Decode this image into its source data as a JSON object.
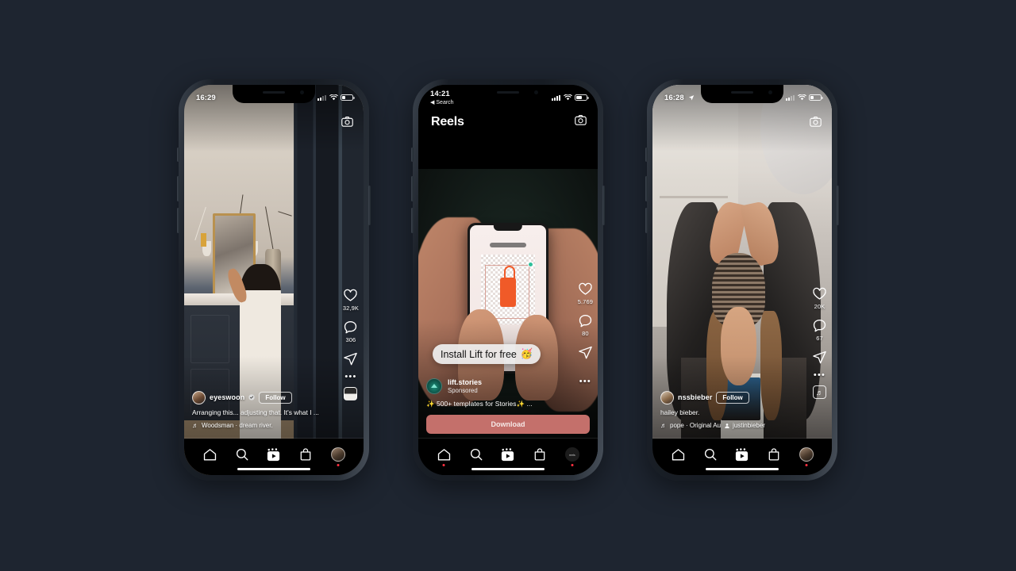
{
  "background_color": "#1e2530",
  "phones": [
    {
      "id": "phone-left",
      "app": "Instagram",
      "screen": "reels-feed",
      "status_bar": {
        "time": "16:29",
        "signal": "2 of 4 bars",
        "wifi": "wifi-icon",
        "battery": "battery-low-icon"
      },
      "camera_button": "camera-icon",
      "post": {
        "username": "eyeswoon",
        "verified": true,
        "follow_label": "Follow",
        "caption": "Arranging this... adjusting that. It's what I ...",
        "audio": "Woodsman · dream river.",
        "audio_icon": "music-note-icon"
      },
      "actions": {
        "like_count": "32,9K",
        "comment_count": "306",
        "share": "share-icon",
        "more": "more-options-icon",
        "audio_thumb": "audio-cover-thumbnail"
      },
      "tabbar": [
        "home-icon",
        "search-icon",
        "reels-icon",
        "shop-icon",
        "profile-avatar"
      ]
    },
    {
      "id": "phone-middle",
      "app": "Instagram",
      "screen": "reels-sponsored",
      "status_bar": {
        "time": "14:21",
        "back_label": "Search",
        "signal": "4 of 4 bars",
        "wifi": "wifi-icon",
        "battery": "battery-half-icon"
      },
      "header": {
        "title": "Reels",
        "camera_button": "camera-icon"
      },
      "overlay_bubble": {
        "text": "Install Lift for free",
        "emoji": "🥳"
      },
      "ad": {
        "account": "lift.stories",
        "label": "Sponsored",
        "caption": "✨ 500+ templates for Stories✨ ...",
        "cta_label": "Download",
        "cta_color": "#c4706b"
      },
      "actions": {
        "like_count": "5.769",
        "comment_count": "80",
        "share": "share-icon",
        "more": "more-options-icon"
      },
      "tabbar": [
        "home-icon",
        "search-icon",
        "reels-icon",
        "shop-icon",
        "reels-avatar"
      ]
    },
    {
      "id": "phone-right",
      "app": "Instagram",
      "screen": "reels-feed",
      "status_bar": {
        "time": "16:28",
        "location_arrow": true,
        "signal": "2 of 4 bars",
        "wifi": "wifi-icon",
        "battery": "battery-low-icon"
      },
      "camera_button": "camera-icon",
      "post": {
        "username": "nssbieber",
        "verified": false,
        "follow_label": "Follow",
        "caption": "hailey bieber.",
        "audio": "pope · Original Au",
        "audio_icon": "music-note-icon",
        "tagged_user": "justinbieber",
        "tag_icon": "person-icon"
      },
      "actions": {
        "like_count": "20K",
        "comment_count": "67",
        "share": "share-icon",
        "more": "more-options-icon",
        "audio_thumb": "audio-note-thumbnail"
      },
      "tabbar": [
        "home-icon",
        "search-icon",
        "reels-icon",
        "shop-icon",
        "profile-avatar"
      ]
    }
  ]
}
